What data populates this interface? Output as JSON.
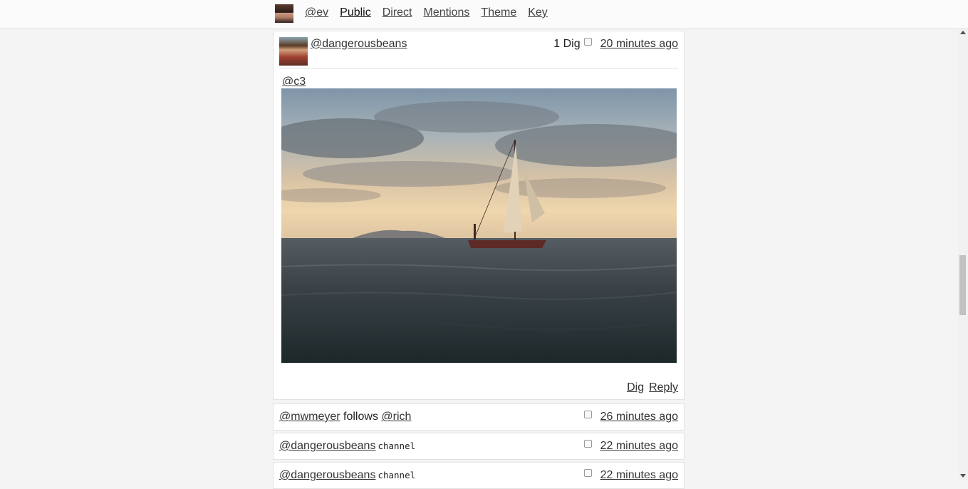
{
  "nav": {
    "user": "@ev",
    "items": [
      "Public",
      "Direct",
      "Mentions",
      "Theme",
      "Key"
    ],
    "active": "Public"
  },
  "post": {
    "author": "@dangerousbeans",
    "dig_count": "1 Dig",
    "time": "20 minutes ago",
    "mention": "@c3",
    "actions": {
      "dig": "Dig",
      "reply": "Reply"
    }
  },
  "activity": [
    {
      "actor": "@mwmeyer",
      "verb": "follows",
      "target": "@rich",
      "time": "26 minutes ago"
    },
    {
      "actor": "@dangerousbeans",
      "tag": "channel",
      "time": "22 minutes ago"
    },
    {
      "actor": "@dangerousbeans",
      "tag": "channel",
      "time": "22 minutes ago"
    }
  ]
}
